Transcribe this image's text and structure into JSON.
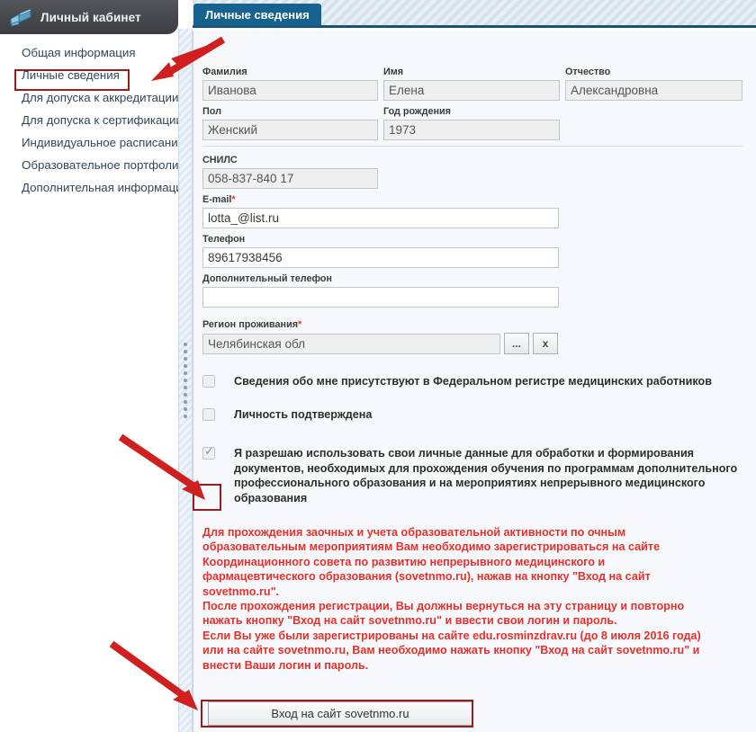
{
  "sidebar": {
    "title": "Личный кабинет",
    "logo_icon": "book-icon",
    "items": [
      {
        "label": "Общая информация"
      },
      {
        "label": "Личные сведения"
      },
      {
        "label": "Для допуска к аккредитации"
      },
      {
        "label": "Для допуска к сертификации"
      },
      {
        "label": "Индивидуальное расписание"
      },
      {
        "label": "Образовательное портфолио"
      },
      {
        "label": "Дополнительная информация"
      }
    ],
    "active_index": 1
  },
  "tab": {
    "label": "Личные сведения"
  },
  "form": {
    "last_name": {
      "label": "Фамилия",
      "value": "Иванова",
      "readonly": true
    },
    "first_name": {
      "label": "Имя",
      "value": "Елена",
      "readonly": true
    },
    "patronymic": {
      "label": "Отчество",
      "value": "Александровна",
      "readonly": true
    },
    "gender": {
      "label": "Пол",
      "value": "Женский",
      "readonly": true
    },
    "birth_year": {
      "label": "Год рождения",
      "value": "1973",
      "readonly": true
    },
    "snils": {
      "label": "СНИЛС",
      "value": "058-837-840 17",
      "readonly": true
    },
    "email": {
      "label": "E-mail",
      "required_mark": "*",
      "value": "lotta_@list.ru",
      "placeholder": ""
    },
    "phone": {
      "label": "Телефон",
      "value": "89617938456",
      "placeholder": ""
    },
    "extra_phone": {
      "label": "Дополнительный телефон",
      "value": "",
      "placeholder": ""
    },
    "region": {
      "label": "Регион проживания",
      "required_mark": "*",
      "value": "Челябинская обл",
      "readonly": true
    },
    "region_pick_label": "...",
    "region_clear_label": "x"
  },
  "checkboxes": [
    {
      "label": "Сведения обо мне присутствуют в Федеральном регистре медицинских работников",
      "checked": false
    },
    {
      "label": "Личность подтверждена",
      "checked": false
    },
    {
      "label": "Я разрешаю использовать свои личные данные для обработки и формирования документов, необходимых для прохождения обучения по программам дополнительного профессионального образования и на мероприятиях непрерывного медицинского образования",
      "checked": true
    }
  ],
  "notice": {
    "color": "#e8302a",
    "paragraphs": [
      "Для прохождения заочных и учета образовательной активности по очным образовательным мероприятиям Вам необходимо зарегистрироваться на сайте Координационного совета по развитию непрерывного медицинского и фармацевтического образования (sovetnmo.ru), нажав на кнопку \"Вход на сайт sovetnmo.ru\".",
      "После прохождения регистрации, Вы должны вернуться на эту страницу и повторно нажать кнопку \"Вход на сайт sovetnmo.ru\" и ввести свои логин и пароль.",
      "Если Вы уже были зарегистрированы на сайте edu.rosminzdrav.ru (до 8 июля 2016 года) или на сайте sovetnmo.ru, Вам необходимо нажать кнопку \"Вход на сайт sovetnmo.ru\" и внести Ваши логин и пароль."
    ]
  },
  "login_button": {
    "label": "Вход на сайт sovetnmo.ru"
  },
  "annotations": {
    "highlight_color": "#a81818",
    "arrow_color": "#cf1f1f",
    "boxes": [
      "menu-item-personal-info",
      "consent-checkbox",
      "login-button"
    ],
    "arrows": [
      "arrow-to-menu-item",
      "arrow-to-consent-checkbox",
      "arrow-to-login-button"
    ]
  }
}
